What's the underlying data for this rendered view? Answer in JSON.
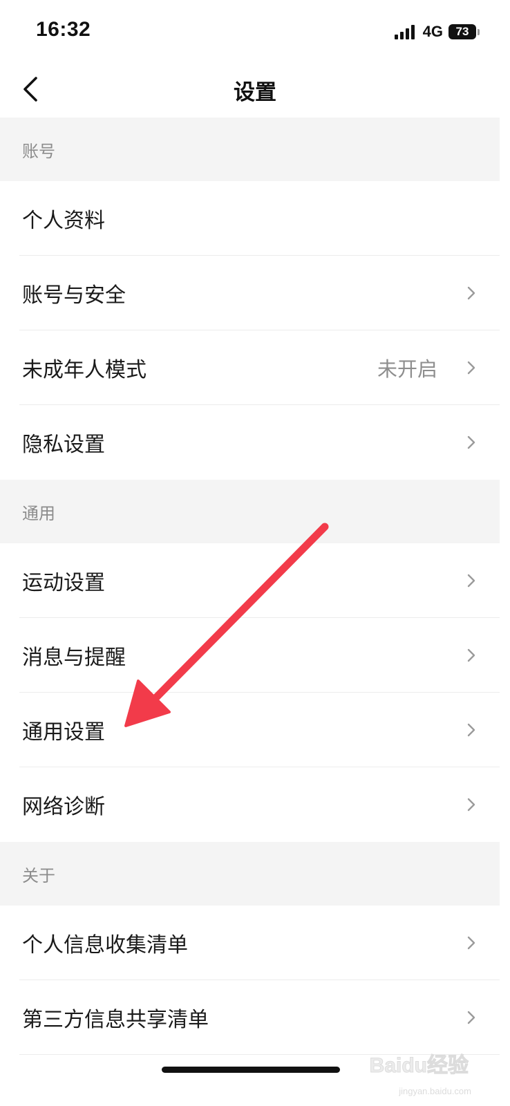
{
  "status_bar": {
    "time": "16:32",
    "network": "4G",
    "battery": "73"
  },
  "nav": {
    "title": "设置"
  },
  "sections": [
    {
      "header": "账号",
      "items": [
        {
          "label": "个人资料"
        },
        {
          "label": "账号与安全"
        },
        {
          "label": "未成年人模式",
          "value": "未开启"
        },
        {
          "label": "隐私设置"
        }
      ]
    },
    {
      "header": "通用",
      "items": [
        {
          "label": "运动设置"
        },
        {
          "label": "消息与提醒"
        },
        {
          "label": "通用设置"
        },
        {
          "label": "网络诊断"
        }
      ]
    },
    {
      "header": "关于",
      "items": [
        {
          "label": "个人信息收集清单"
        },
        {
          "label": "第三方信息共享清单"
        }
      ]
    }
  ],
  "annotation": {
    "color": "#f23b4a",
    "target": "通用设置"
  },
  "watermark": {
    "logo": "Baidu经验",
    "sub": "jingyan.baidu.com"
  },
  "colors": {
    "section_bg": "#f4f4f4",
    "section_text": "#8c8c8c",
    "value_text": "#8e8e8e"
  }
}
